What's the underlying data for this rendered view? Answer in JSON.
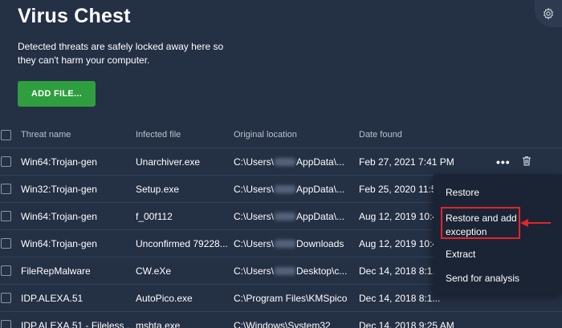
{
  "header": {
    "title": "Virus Chest",
    "subtitle": "Detected threats are safely locked away here so they can't harm your computer.",
    "add_button_label": "ADD FILE..."
  },
  "table": {
    "columns": [
      "Threat name",
      "Infected file",
      "Original location",
      "Date found"
    ],
    "rows": [
      {
        "threat": "Win64:Trojan-gen",
        "file": "Unarchiver.exe",
        "loc_prefix": "C:\\Users\\",
        "loc_suffix": "AppData\\...",
        "date": "Feb 27, 2021 7:41 PM"
      },
      {
        "threat": "Win32:Trojan-gen",
        "file": "Setup.exe",
        "loc_prefix": "C:\\Users\\",
        "loc_suffix": "AppData\\...",
        "date": "Feb 25, 2020 11:5..."
      },
      {
        "threat": "Win64:Trojan-gen",
        "file": "f_00f112",
        "loc_prefix": "C:\\Users\\",
        "loc_suffix": "AppData\\...",
        "date": "Aug 12, 2019 10:4..."
      },
      {
        "threat": "Win64:Trojan-gen",
        "file": "Unconfirmed 79228...",
        "loc_prefix": "C:\\Users\\",
        "loc_suffix": "Downloads",
        "date": "Aug 12, 2019 10:4..."
      },
      {
        "threat": "FileRepMalware",
        "file": "CW.eXe",
        "loc_prefix": "C:\\Users\\",
        "loc_suffix": "Desktop\\c...",
        "date": "Dec 14, 2018 8:1..."
      },
      {
        "threat": "IDP.ALEXA.51",
        "file": "AutoPico.exe",
        "loc_prefix": "C:\\Program Files\\KMSpico",
        "loc_suffix": "",
        "date": "Dec 14, 2018 8:1..."
      },
      {
        "threat": "IDP.ALEXA.51 - Fileless ...",
        "file": "mshta.exe",
        "loc_prefix": "C:\\Windows\\System32",
        "loc_suffix": "",
        "date": "Dec 14, 2018 9:25 AM"
      }
    ]
  },
  "row_actions": {
    "more_icon": "more-horizontal-icon",
    "delete_icon": "trash-icon"
  },
  "context_menu": {
    "items": [
      "Restore",
      "Restore and add exception",
      "Extract",
      "Send for analysis"
    ]
  },
  "colors": {
    "background": "#243044",
    "accent_green": "#2e9e3e",
    "menu_background": "#1b2434",
    "annotation_red": "#e0252b"
  }
}
